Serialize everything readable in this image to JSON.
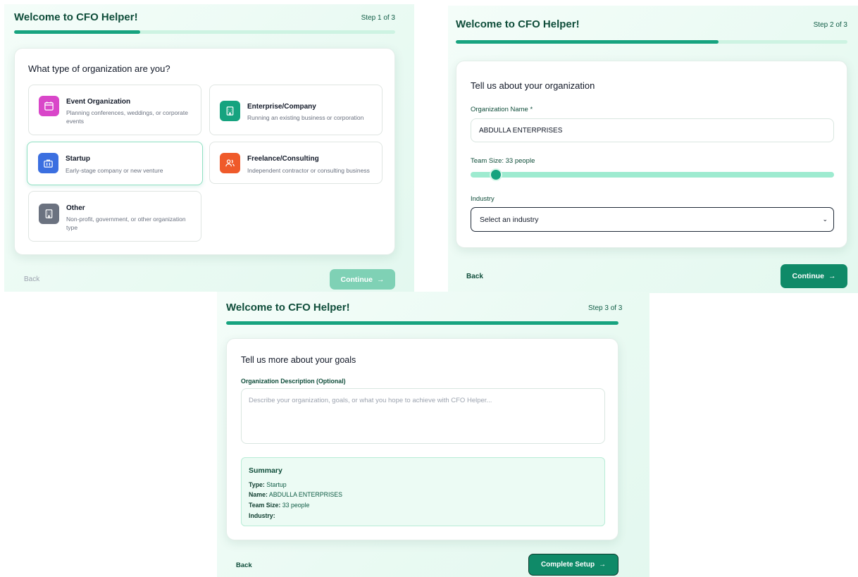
{
  "app_title": "Welcome to CFO Helper!",
  "colors": {
    "brand": "#16a37f",
    "button_dark": "#0f8a68",
    "button_disabled": "#7fd1b5",
    "track": "#cdf3e2"
  },
  "step1": {
    "step_text": "Step 1 of 3",
    "progress": 0.33,
    "heading": "What type of organization are you?",
    "options": [
      {
        "label": "Event Organization",
        "desc": "Planning conferences, weddings, or corporate events",
        "icon": "calendar-icon",
        "color": "#d946c9"
      },
      {
        "label": "Enterprise/Company",
        "desc": "Running an existing business or corporation",
        "icon": "building-icon",
        "color": "#16a37f"
      },
      {
        "label": "Startup",
        "desc": "Early-stage company or new venture",
        "icon": "briefcase-icon",
        "color": "#3b6fe0",
        "selected": true
      },
      {
        "label": "Freelance/Consulting",
        "desc": "Independent contractor or consulting business",
        "icon": "users-icon",
        "color": "#ef5a2a"
      },
      {
        "label": "Other",
        "desc": "Non-profit, government, or other organization type",
        "icon": "building-icon",
        "color": "#6b7280"
      }
    ],
    "back_label": "Back",
    "continue_label": "Continue"
  },
  "step2": {
    "step_text": "Step 2 of 3",
    "progress": 0.67,
    "heading": "Tell us about your organization",
    "name_label": "Organization Name *",
    "name_value": "ABDULLA ENTERPRISES",
    "team_label": "Team Size: 33 people",
    "team_value": 33,
    "team_fraction": 0.07,
    "industry_label": "Industry",
    "industry_value": "Select an industry",
    "back_label": "Back",
    "continue_label": "Continue"
  },
  "step3": {
    "step_text": "Step 3 of 3",
    "progress": 1.0,
    "heading": "Tell us more about your goals",
    "desc_label": "Organization Description (Optional)",
    "desc_placeholder": "Describe your organization, goals, or what you hope to achieve with CFO Helper...",
    "summary": {
      "title": "Summary",
      "type_key": "Type:",
      "type_value": "Startup",
      "name_key": "Name:",
      "name_value": "ABDULLA ENTERPRISES",
      "team_key": "Team Size:",
      "team_value": "33 people",
      "industry_key": "Industry:",
      "industry_value": ""
    },
    "back_label": "Back",
    "complete_label": "Complete Setup"
  }
}
